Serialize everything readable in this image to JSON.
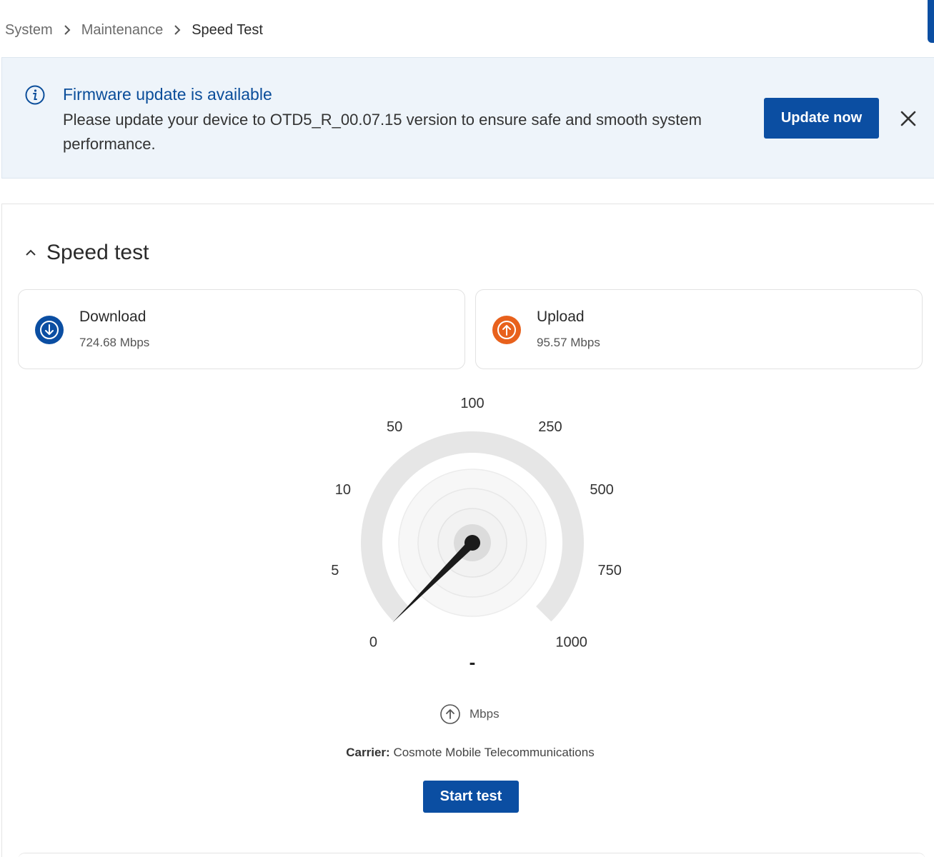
{
  "breadcrumb": {
    "items": [
      "System",
      "Maintenance",
      "Speed Test"
    ]
  },
  "banner": {
    "icon": "info-icon",
    "title": "Firmware update is available",
    "message": "Please update your device to OTD5_R_00.07.15 version to ensure safe and smooth system performance.",
    "update_label": "Update now",
    "close_icon": "close-icon"
  },
  "speed_test": {
    "title": "Speed test",
    "download": {
      "label": "Download",
      "value": "724.68 Mbps",
      "icon": "arrow-down-circle-icon",
      "color": "#0b4ea2"
    },
    "upload": {
      "label": "Upload",
      "value": "95.57 Mbps",
      "icon": "arrow-up-circle-icon",
      "color": "#e8611c"
    },
    "gauge": {
      "scale_labels": [
        "0",
        "5",
        "10",
        "50",
        "100",
        "250",
        "500",
        "750",
        "1000"
      ],
      "current_value": 0,
      "reading": "-"
    },
    "direction_icon": "arrow-up-circle-icon",
    "unit": "Mbps",
    "carrier_label": "Carrier:",
    "carrier_value": "Cosmote Mobile Telecommunications",
    "start_label": "Start test"
  },
  "colors": {
    "primary": "#0b4ea2",
    "upload_accent": "#e8611c",
    "banner_bg": "#eef4fa",
    "gauge_track": "#e6e6e6"
  }
}
